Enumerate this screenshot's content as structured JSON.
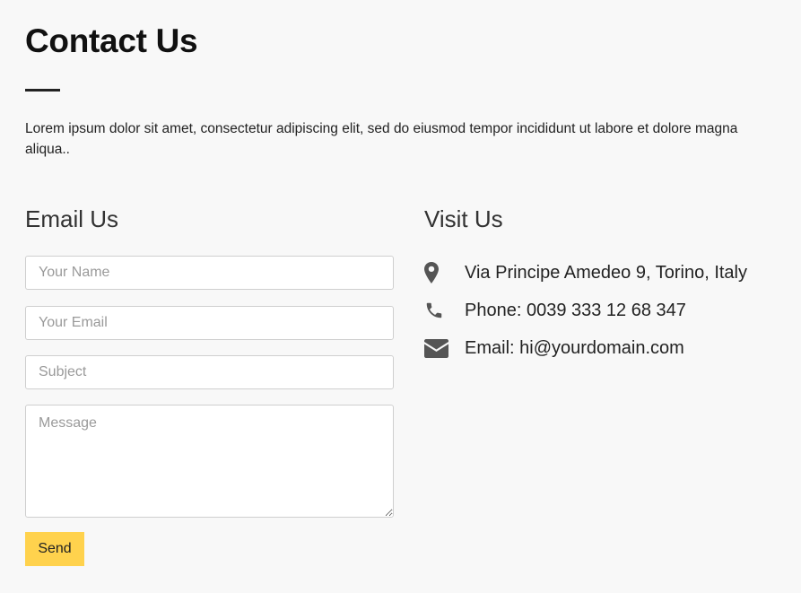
{
  "page": {
    "title": "Contact Us",
    "intro": "Lorem ipsum dolor sit amet, consectetur adipiscing elit, sed do eiusmod tempor incididunt ut labore et dolore magna aliqua.."
  },
  "email_section": {
    "heading": "Email Us",
    "form": {
      "name_placeholder": "Your Name",
      "name_value": "",
      "email_placeholder": "Your Email",
      "email_value": "",
      "subject_placeholder": "Subject",
      "subject_value": "",
      "message_placeholder": "Message",
      "message_value": "",
      "submit_label": "Send"
    }
  },
  "visit_section": {
    "heading": "Visit Us",
    "items": [
      {
        "icon": "map-marker-icon",
        "text": "Via Principe Amedeo 9, Torino, Italy"
      },
      {
        "icon": "phone-icon",
        "text": "Phone: 0039 333 12 68 347"
      },
      {
        "icon": "envelope-icon",
        "text": "Email: hi@yourdomain.com"
      }
    ]
  },
  "colors": {
    "background": "#f8f8f8",
    "accent": "#ffd24d",
    "icon": "#555555",
    "text": "#222222"
  }
}
